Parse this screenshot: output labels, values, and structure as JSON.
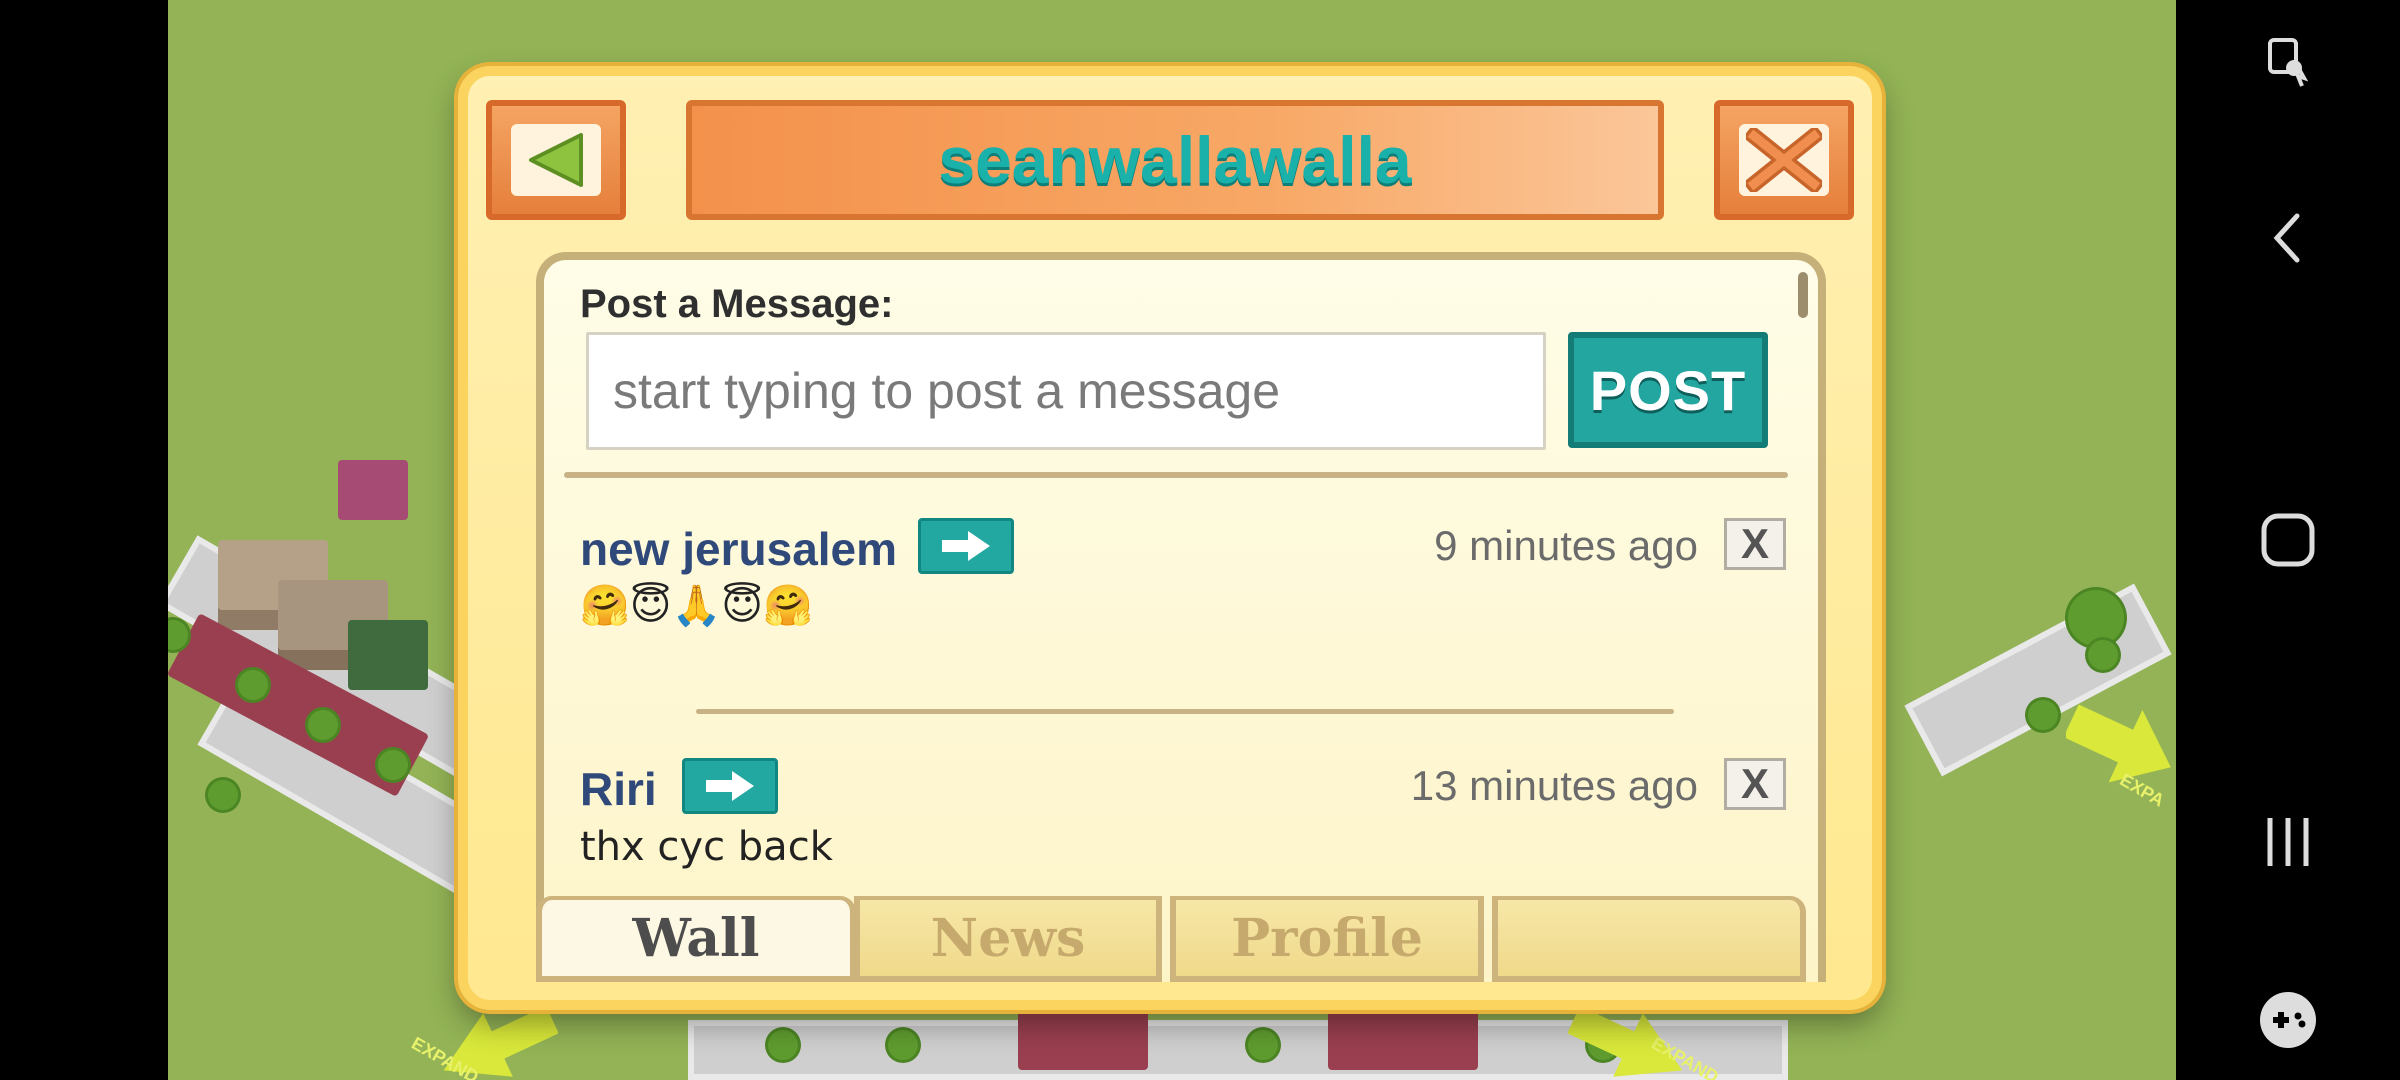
{
  "dialog": {
    "title": "seanwallawalla",
    "post_label": "Post a Message:",
    "input_placeholder": "start typing to post a message",
    "post_button": "POST"
  },
  "posts": [
    {
      "author": "new jerusalem",
      "time": "9 minutes ago",
      "body": "🤗😇🙏😇🤗",
      "delete_label": "X"
    },
    {
      "author": "Riri",
      "time": "13 minutes ago",
      "body": "thx cyc back",
      "delete_label": "X"
    }
  ],
  "tabs": [
    {
      "label": "Wall",
      "active": true
    },
    {
      "label": "News",
      "active": false
    },
    {
      "label": "Profile",
      "active": false
    },
    {
      "label": "",
      "active": false
    }
  ],
  "game_labels": {
    "expand_left": "EXPAND",
    "expand_bottom": "EXPAND",
    "expand_right": "EXPA"
  },
  "icons": {
    "back": "back-triangle-icon",
    "close": "close-x-icon",
    "arrow": "arrow-right-icon",
    "nav_back": "chevron-left-icon",
    "nav_home": "home-square-icon",
    "nav_recents": "recents-icon",
    "nav_game": "gamepad-icon",
    "nav_top": "screenshot-touch-icon"
  },
  "colors": {
    "accent_teal": "#23a6a0",
    "title_orange": "#f3914b",
    "panel_yellow": "#fff0b3",
    "grass": "#93b356"
  }
}
